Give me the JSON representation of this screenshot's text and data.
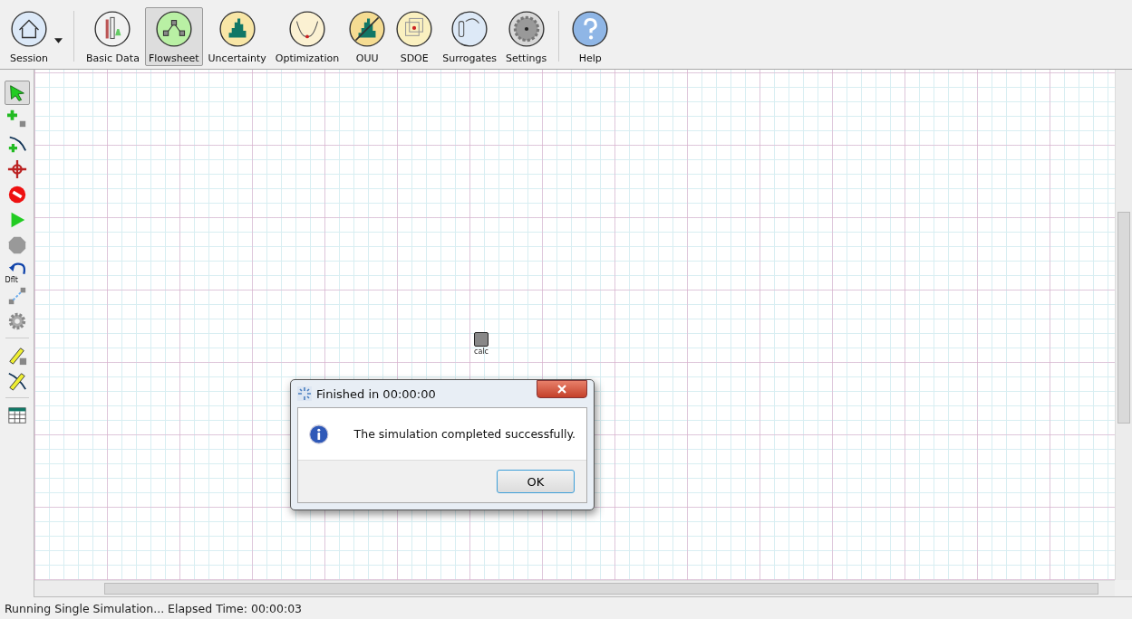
{
  "toolbar": [
    {
      "label": "Session",
      "kind": "session",
      "selected": false,
      "dropdown": true
    },
    {
      "label": "Basic Data",
      "kind": "basic",
      "selected": false,
      "dropdown": false
    },
    {
      "label": "Flowsheet",
      "kind": "flowsheet",
      "selected": true,
      "dropdown": false
    },
    {
      "label": "Uncertainty",
      "kind": "uncertainty",
      "selected": false,
      "dropdown": false
    },
    {
      "label": "Optimization",
      "kind": "optimization",
      "selected": false,
      "dropdown": false
    },
    {
      "label": "OUU",
      "kind": "ouu",
      "selected": false,
      "dropdown": false
    },
    {
      "label": "SDOE",
      "kind": "sdoe",
      "selected": false,
      "dropdown": false
    },
    {
      "label": "Surrogates",
      "kind": "surrogates",
      "selected": false,
      "dropdown": false
    },
    {
      "label": "Settings",
      "kind": "settings",
      "selected": false,
      "dropdown": false
    },
    {
      "label": "Help",
      "kind": "help",
      "selected": false,
      "dropdown": false
    }
  ],
  "tools": [
    {
      "kind": "select",
      "selected": true
    },
    {
      "kind": "add-node",
      "selected": false
    },
    {
      "kind": "add-edge",
      "selected": false
    },
    {
      "kind": "center",
      "selected": false
    },
    {
      "kind": "stop",
      "selected": false
    },
    {
      "kind": "run",
      "selected": false
    },
    {
      "kind": "halt",
      "selected": false
    },
    {
      "kind": "reset",
      "selected": false,
      "label": "Dflt"
    },
    {
      "kind": "link",
      "selected": false
    },
    {
      "kind": "gear",
      "selected": false
    },
    {
      "kind": "edit-node",
      "selected": false
    },
    {
      "kind": "edit-edge",
      "selected": false
    },
    {
      "kind": "table",
      "selected": false
    }
  ],
  "canvas": {
    "nodes": [
      {
        "label": "calc"
      }
    ]
  },
  "dialog": {
    "title": "Finished in 00:00:00",
    "message": "The simulation completed successfully.",
    "buttons": [
      "OK"
    ]
  },
  "status_bar": "Running Single Simulation... Elapsed Time: 00:00:03"
}
